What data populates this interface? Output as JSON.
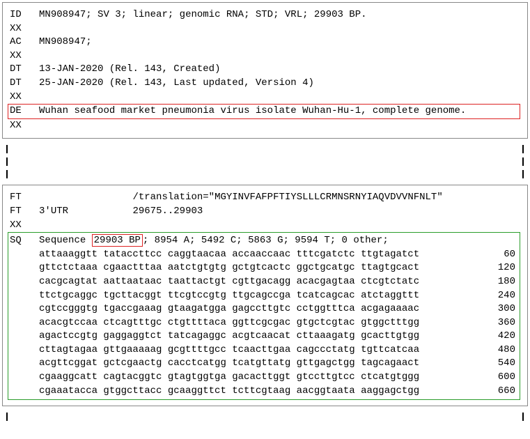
{
  "header": {
    "lines": [
      {
        "tag": "ID",
        "text": "MN908947; SV 3; linear; genomic RNA; STD; VRL; 29903 BP."
      },
      {
        "tag": "XX",
        "text": ""
      },
      {
        "tag": "AC",
        "text": "MN908947;"
      },
      {
        "tag": "XX",
        "text": ""
      },
      {
        "tag": "DT",
        "text": "13-JAN-2020 (Rel. 143, Created)"
      },
      {
        "tag": "DT",
        "text": "25-JAN-2020 (Rel. 143, Last updated, Version 4)"
      },
      {
        "tag": "XX",
        "text": ""
      }
    ],
    "de": {
      "tag": "DE",
      "text": "Wuhan seafood market pneumonia virus isolate Wuhan-Hu-1, complete genome."
    },
    "de_after": {
      "tag": "XX",
      "text": ""
    }
  },
  "ft_block": {
    "lines": [
      {
        "tag": "FT",
        "col2": "",
        "col3": "/translation=\"MGYINVFAFPFTIYSLLLCRMNSRNYIAQVDVVNFNLT\""
      },
      {
        "tag": "FT",
        "col2": "3'UTR",
        "col3": "29675..29903"
      },
      {
        "tag": "XX",
        "col2": "",
        "col3": ""
      }
    ]
  },
  "sq": {
    "tag": "SQ",
    "prefix": "Sequence ",
    "bp": "29903 BP",
    "suffix": "; 8954 A; 5492 C; 5863 G; 9594 T; 0 other;",
    "rows": [
      {
        "g": [
          "attaaaggtt",
          "tataccttcc",
          "caggtaacaa",
          "accaaccaac",
          "tttcgatctc",
          "ttgtagatct"
        ],
        "n": 60
      },
      {
        "g": [
          "gttctctaaa",
          "cgaactttaa",
          "aatctgtgtg",
          "gctgtcactc",
          "ggctgcatgc",
          "ttagtgcact"
        ],
        "n": 120
      },
      {
        "g": [
          "cacgcagtat",
          "aattaataac",
          "taattactgt",
          "cgttgacagg",
          "acacgagtaa",
          "ctcgtctatc"
        ],
        "n": 180
      },
      {
        "g": [
          "ttctgcaggc",
          "tgcttacggt",
          "ttcgtccgtg",
          "ttgcagccga",
          "tcatcagcac",
          "atctaggttt"
        ],
        "n": 240
      },
      {
        "g": [
          "cgtccgggtg",
          "tgaccgaaag",
          "gtaagatgga",
          "gagccttgtc",
          "cctggtttca",
          "acgagaaaac"
        ],
        "n": 300
      },
      {
        "g": [
          "acacgtccaa",
          "ctcagtttgc",
          "ctgttttaca",
          "ggttcgcgac",
          "gtgctcgtac",
          "gtggctttgg"
        ],
        "n": 360
      },
      {
        "g": [
          "agactccgtg",
          "gaggaggtct",
          "tatcagaggc",
          "acgtcaacat",
          "cttaaagatg",
          "gcacttgtgg"
        ],
        "n": 420
      },
      {
        "g": [
          "cttagtagaa",
          "gttgaaaaag",
          "gcgttttgcc",
          "tcaacttgaa",
          "cagccctatg",
          "tgttcatcaa"
        ],
        "n": 480
      },
      {
        "g": [
          "acgttcggat",
          "gctcgaactg",
          "cacctcatgg",
          "tcatgttatg",
          "gttgagctgg",
          "tagcagaact"
        ],
        "n": 540
      },
      {
        "g": [
          "cgaaggcatt",
          "cagtacggtc",
          "gtagtggtga",
          "gacacttggt",
          "gtccttgtcc",
          "ctcatgtggg"
        ],
        "n": 600
      },
      {
        "g": [
          "cgaaatacca",
          "gtggcttacc",
          "gcaaggttct",
          "tcttcgtaag",
          "aacggtaata",
          "aaggagctgg"
        ],
        "n": 660
      }
    ]
  }
}
